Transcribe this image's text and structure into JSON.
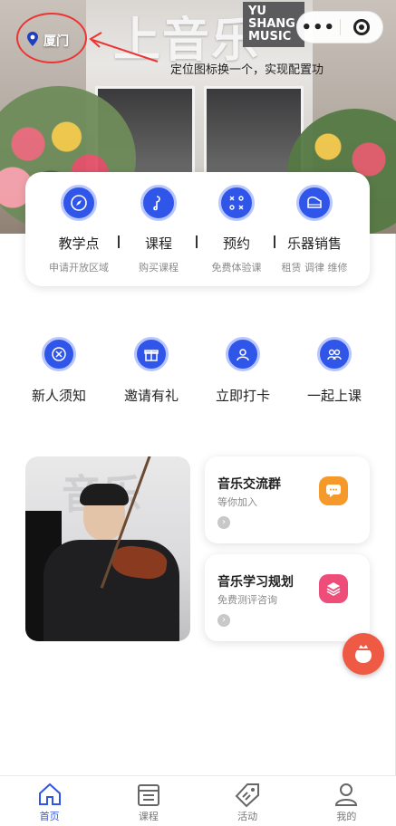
{
  "location": {
    "city": "厦门"
  },
  "annotation": {
    "note": "定位图标换一个，实现配置功"
  },
  "banner": {
    "sign_text": "上音乐",
    "sign_logo": "YU SHANG MUSIC"
  },
  "menu": [
    {
      "title": "教学点",
      "subtitle": "申请开放区域"
    },
    {
      "title": "课程",
      "subtitle": "购买课程"
    },
    {
      "title": "预约",
      "subtitle": "免费体验课"
    },
    {
      "title": "乐器销售",
      "subtitle": "租赁 调律 维修"
    }
  ],
  "quick_links": [
    {
      "label": "新人须知"
    },
    {
      "label": "邀请有礼"
    },
    {
      "label": "立即打卡"
    },
    {
      "label": "一起上课"
    }
  ],
  "photo_card": {
    "bg_text": "音乐"
  },
  "side_cards": [
    {
      "title": "音乐交流群",
      "subtitle": "等你加入",
      "icon": "chat-icon",
      "color": "#f59a2a"
    },
    {
      "title": "音乐学习规划",
      "subtitle": "免费测评咨询",
      "icon": "layers-icon",
      "color": "#ee4d7a"
    }
  ],
  "tabbar": [
    {
      "label": "首页",
      "active": true,
      "icon": "home-icon"
    },
    {
      "label": "课程",
      "active": false,
      "icon": "calendar-icon"
    },
    {
      "label": "活动",
      "active": false,
      "icon": "tag-icon"
    },
    {
      "label": "我的",
      "active": false,
      "icon": "user-icon"
    }
  ],
  "colors": {
    "accent": "#2f56e8",
    "fab": "#ef5a44",
    "annotation": "#e33333"
  }
}
